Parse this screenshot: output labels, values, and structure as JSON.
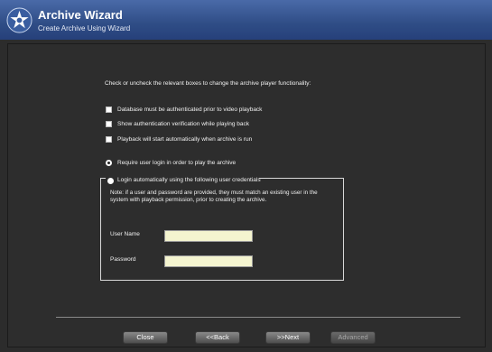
{
  "header": {
    "title": "Archive Wizard",
    "subtitle": "Create Archive Using Wizard",
    "logo_icon": "archive-star-icon",
    "color": "#2f4d86"
  },
  "main": {
    "instruction": "Check or uncheck the relevant boxes to change the archive player functionality:",
    "checkboxes": [
      {
        "label": "Database must be authenticated prior to video playback",
        "checked": false
      },
      {
        "label": "Show authentication verification while playing back",
        "checked": false
      },
      {
        "label": "Playback will start automatically when archive is run",
        "checked": false
      }
    ],
    "radio_require_login": {
      "label": "Require user login in order to play the archive",
      "selected": true
    },
    "radio_auto_login": {
      "label": "Login automatically using the following user credentials",
      "selected": false
    },
    "note": "Note: if a user and password are provided, they must match an existing user in the system with playback permission, prior to creating the archive.",
    "username_label": "User Name",
    "username_value": "",
    "password_label": "Password",
    "password_value": ""
  },
  "buttons": {
    "close": "Close",
    "back": "<<Back",
    "next": ">>Next",
    "advanced": "Advanced"
  }
}
